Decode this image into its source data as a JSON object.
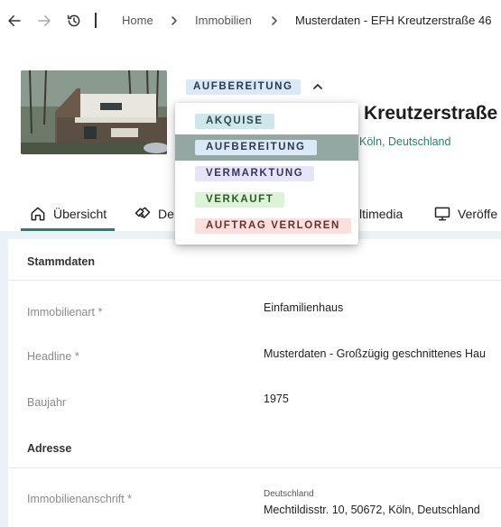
{
  "breadcrumb": {
    "items": [
      "Home",
      "Immobilien",
      "Musterdaten - EFH Kreutzerstraße 46"
    ]
  },
  "header": {
    "status": "AUFBEREITUNG",
    "title": "Kreutzerstraße",
    "city": "Köln, Deutschland"
  },
  "status_menu": {
    "options": [
      {
        "label": "AKQUISE",
        "bg": "#cfe6ea",
        "fg": "#2a4a50"
      },
      {
        "label": "AUFBEREITUNG",
        "bg": "#dbe8f8",
        "fg": "#2a3a4f"
      },
      {
        "label": "VERMARKTUNG",
        "bg": "#e6e4f7",
        "fg": "#3a3560"
      },
      {
        "label": "VERKAUFT",
        "bg": "#ddf3d8",
        "fg": "#2f5a2a"
      },
      {
        "label": "AUFTRAG VERLOREN",
        "bg": "#fbe0e0",
        "fg": "#6a2e2e"
      }
    ],
    "selected_index": 1
  },
  "tabs": [
    {
      "label": "Übersicht",
      "icon": "home-icon"
    },
    {
      "label": "De",
      "icon": "handshake-icon"
    },
    {
      "label": "ltimedia",
      "icon": "multimedia-icon"
    },
    {
      "label": "Veröffe",
      "icon": "monitor-icon"
    }
  ],
  "stammdaten": {
    "title": "Stammdaten",
    "fields": [
      {
        "label": "Immobilienart  *",
        "value": "Einfamilienhaus"
      },
      {
        "label": "Headline  *",
        "value": "Musterdaten - Großzügig geschnittenes Hau"
      },
      {
        "label": "Baujahr",
        "value": "1975"
      }
    ]
  },
  "adresse": {
    "title": "Adresse",
    "field_label": "Immobilienanschrift  *",
    "country": "Deutschland",
    "address": "Mechtildisstr. 10, 50672, Köln, Deutschland"
  },
  "colors": {
    "accent": "#2e7d6e",
    "content_bg": "#e9f2f6"
  }
}
